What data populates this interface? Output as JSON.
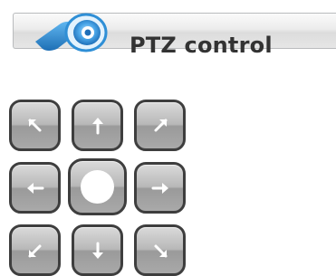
{
  "header": {
    "title": "PTZ control",
    "logo_icon": "camera-logo-icon"
  },
  "ptz_pad": {
    "buttons": [
      {
        "id": "up-left",
        "icon": "arrow-up-left-icon"
      },
      {
        "id": "up",
        "icon": "arrow-up-icon"
      },
      {
        "id": "up-right",
        "icon": "arrow-up-right-icon"
      },
      {
        "id": "left",
        "icon": "arrow-left-icon"
      },
      {
        "id": "center",
        "icon": "center-dot-icon"
      },
      {
        "id": "right",
        "icon": "arrow-right-icon"
      },
      {
        "id": "down-left",
        "icon": "arrow-down-left-icon"
      },
      {
        "id": "down",
        "icon": "arrow-down-icon"
      },
      {
        "id": "down-right",
        "icon": "arrow-down-right-icon"
      }
    ]
  },
  "colors": {
    "logo_blue": "#2f8fd6",
    "button_border": "#3e3e3e",
    "title_text": "#333333"
  }
}
